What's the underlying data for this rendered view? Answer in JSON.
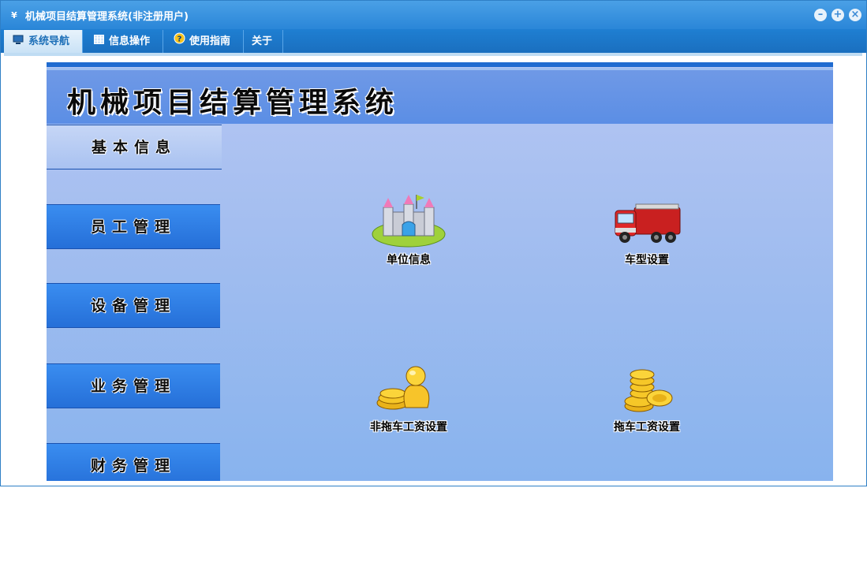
{
  "window": {
    "title": "机械项目结算管理系统(非注册用户)",
    "app_icon": "yf-logo-icon",
    "controls": [
      "minimize-icon",
      "maximize-icon",
      "close-icon"
    ]
  },
  "tabs": [
    {
      "label": "系统导航",
      "icon": "monitor-icon",
      "active": true
    },
    {
      "label": "信息操作",
      "icon": "grid-icon",
      "active": false
    },
    {
      "label": "使用指南",
      "icon": "help-icon",
      "active": false
    },
    {
      "label": "关于",
      "icon": "",
      "active": false
    }
  ],
  "banner": {
    "title": "机械项目结算管理系统"
  },
  "menu": [
    {
      "label": "基本信息",
      "active": true
    },
    {
      "label": "员工管理",
      "active": false
    },
    {
      "label": "设备管理",
      "active": false
    },
    {
      "label": "业务管理",
      "active": false
    },
    {
      "label": "财务管理",
      "active": false
    }
  ],
  "tiles": [
    {
      "label": "单位信息",
      "icon": "castle-icon"
    },
    {
      "label": "车型设置",
      "icon": "fire-truck-icon"
    },
    {
      "label": "非拖车工资设置",
      "icon": "money-bag-icon"
    },
    {
      "label": "拖车工资设置",
      "icon": "gold-coins-icon"
    }
  ],
  "colors": {
    "titlebar": "#2a86d8",
    "tabbar": "#1f7fd2",
    "banner": "#5b8ee5",
    "menu_button": "#2f7fe6",
    "content_background": "#9fbcef"
  }
}
